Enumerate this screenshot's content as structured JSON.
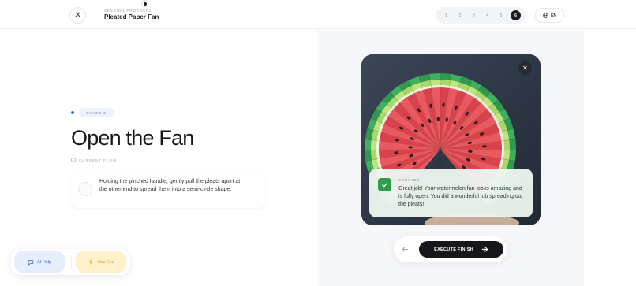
{
  "header": {
    "protocol_label": "SESSION PROTOCOL",
    "title": "Pleated Paper Fan",
    "steps": [
      "1",
      "2",
      "3",
      "4",
      "5",
      "6"
    ],
    "active_step": "6",
    "language": "EN",
    "close_icon": "close-icon",
    "globe_icon": "globe-icon"
  },
  "phase": {
    "badge": "PHASE 6",
    "title": "Open the Fan",
    "flow_label": "CURRENT FLOW",
    "instruction": "Holding the pinched handle, gently pull the pleats apart at the other end to spread them into a semi-circle shape."
  },
  "helpers": {
    "ai_help": "AI Help",
    "live_eye": "Live Eye",
    "ai_icon": "chat-icon",
    "live_icon": "lightning-icon"
  },
  "verification": {
    "label": "VERIFIED",
    "message": "Great job! Your watermelon fan looks amazing and is fully open. You did a wonderful job spreading out the pleats!",
    "accent": "#2e9b4d"
  },
  "actions": {
    "execute": "EXECUTE FINISH",
    "back_icon": "arrow-left-icon",
    "forward_icon": "arrow-right-icon"
  },
  "colors": {
    "accent_blue": "#3a6fd8",
    "dark": "#15171b",
    "watermelon_red": "#e0484f",
    "rind_green": "#3aa85a"
  }
}
